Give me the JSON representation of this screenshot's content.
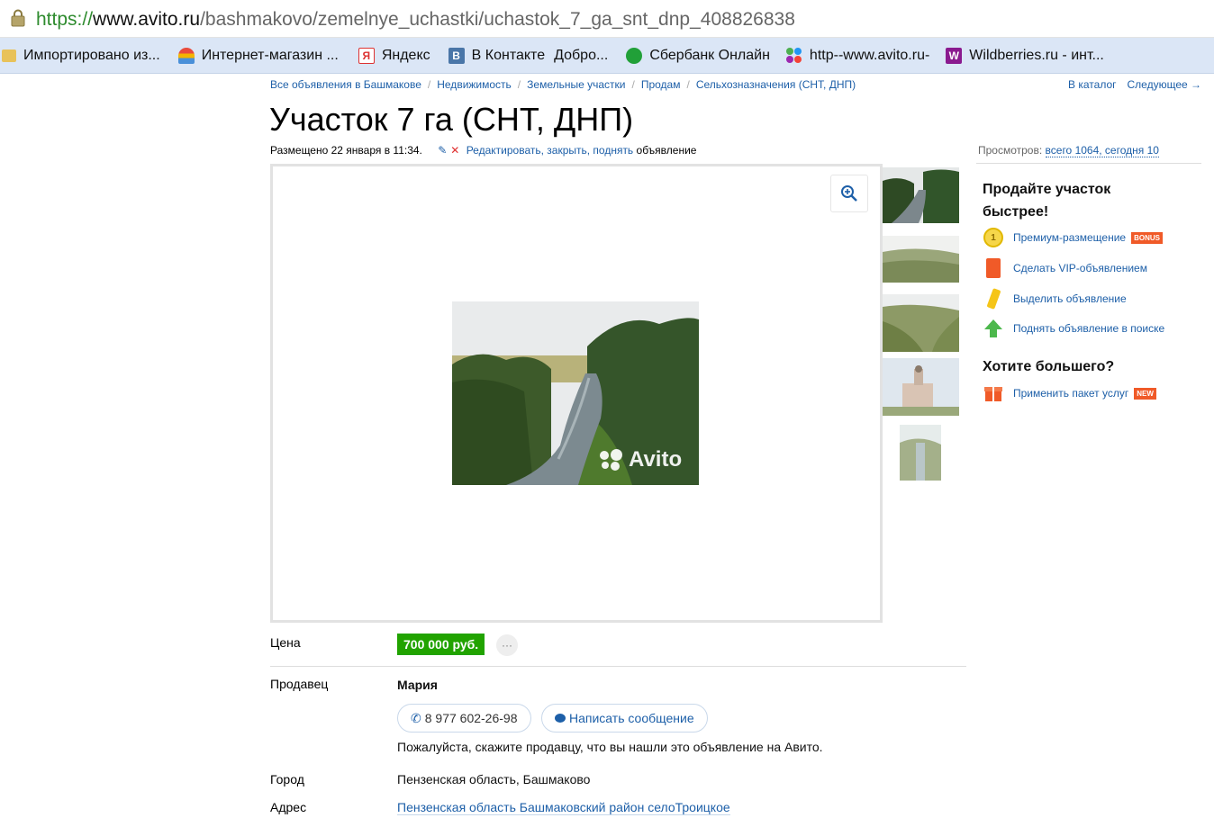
{
  "browser": {
    "url_scheme": "https://",
    "url_host": "www.avito.ru",
    "url_path": "/bashmakovo/zemelnye_uchastki/uchastok_7_ga_snt_dnp_408826838"
  },
  "bookmarks": [
    {
      "label": "Импортировано из...",
      "icon": "folder-icon"
    },
    {
      "label": "Интернет-магазин ...",
      "icon": "shop-icon"
    },
    {
      "label": "Яндекс",
      "icon": "yandex-icon"
    },
    {
      "label": "В Контакте",
      "icon": "vk-icon"
    },
    {
      "label": "Добро...",
      "icon": "page-icon"
    },
    {
      "label": "Сбербанк Онлайн",
      "icon": "sberbank-icon"
    },
    {
      "label": "http--www.avito.ru-",
      "icon": "avito-icon"
    },
    {
      "label": "Wildberries.ru - инт...",
      "icon": "wildberries-icon"
    }
  ],
  "breadcrumbs": [
    "Все объявления в Башмакове",
    "Недвижимость",
    "Земельные участки",
    "Продам",
    "Сельхозназначения (СНТ, ДНП)"
  ],
  "nav": {
    "catalog": "В каталог",
    "next": "Следующее →"
  },
  "listing": {
    "title": "Участок 7 га (СНТ, ДНП)",
    "posted": "Размещено 22 января в 11:34.",
    "edit_links": "Редактировать, закрыть, поднять",
    "edit_suffix": "объявление",
    "views_label": "Просмотров:",
    "views_count": "всего 1064, сегодня 10"
  },
  "gallery": {
    "watermark": "Avito",
    "thumbnail_count": 5
  },
  "promo": {
    "heading": "Продайте участок быстрее!",
    "items": [
      {
        "label": "Премиум-размещение",
        "badge": "BONUS",
        "icon": "coin-icon"
      },
      {
        "label": "Сделать VIP-объявлением",
        "icon": "vip-icon"
      },
      {
        "label": "Выделить объявление",
        "icon": "highlighter-icon"
      },
      {
        "label": "Поднять объявление в поиске",
        "icon": "arrow-up-icon"
      }
    ],
    "heading2": "Хотите большего?",
    "package": {
      "label": "Применить пакет услуг",
      "badge": "NEW",
      "icon": "package-icon"
    }
  },
  "details": {
    "price_label": "Цена",
    "price": "700 000 руб.",
    "more": "···",
    "seller_label": "Продавец",
    "seller_name": "Мария",
    "phone": "8 977 602-26-98",
    "message_button": "Написать сообщение",
    "note": "Пожалуйста, скажите продавцу, что вы нашли это объявление на Авито.",
    "city_label": "Город",
    "city": "Пензенская область, Башмаково",
    "address_label": "Адрес",
    "address": "Пензенская область Башмаковский район селоТроицкое"
  },
  "colors": {
    "link": "#1d5fa8",
    "price_bg": "#21a300",
    "badge": "#f05a28"
  }
}
